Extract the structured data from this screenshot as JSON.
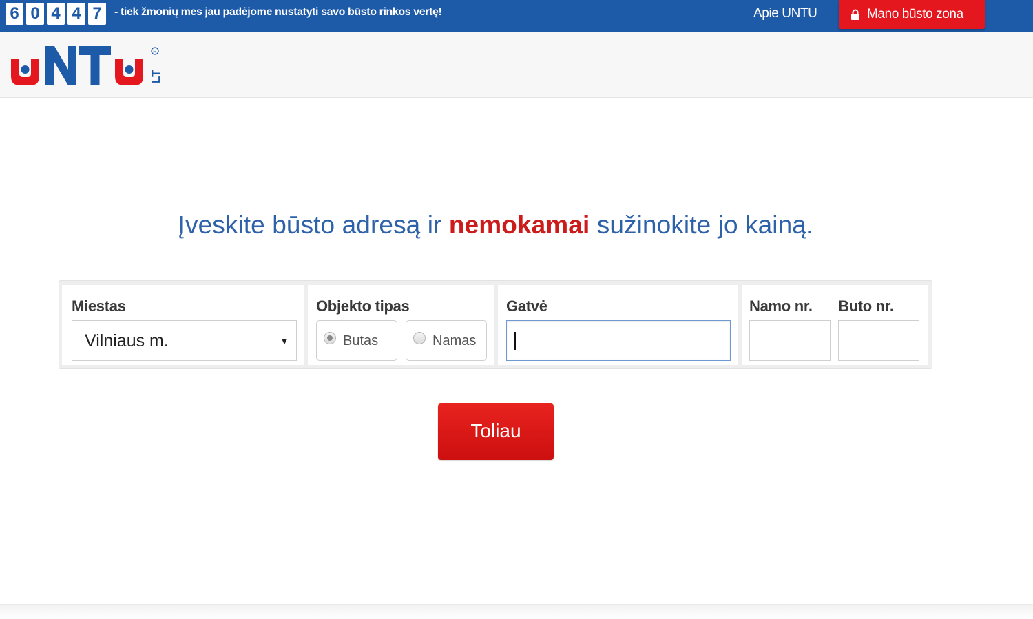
{
  "topbar": {
    "counter_digits": [
      "6",
      "0",
      "4",
      "4",
      "7"
    ],
    "counter_text": "- tiek žmonių mes jau padėjome nustatyti savo būsto rinkos vertę!",
    "about_link": "Apie UNTU",
    "zone_button": "Mano būsto zona",
    "colors": {
      "bar": "#1d5aa8",
      "button": "#e3171d"
    }
  },
  "logo": {
    "wordmark": "uNTu",
    "suffix": "LT",
    "colors": {
      "blue": "#1d5aa8",
      "red": "#e3171d"
    }
  },
  "main": {
    "headline_prefix": "Įveskite būsto adresą ir ",
    "headline_emphasis": "nemokamai",
    "headline_suffix": " sužinokite jo kainą."
  },
  "form": {
    "city": {
      "label": "Miestas",
      "value": "Vilniaus m."
    },
    "object_type": {
      "label": "Objekto tipas",
      "options": [
        {
          "label": "Butas",
          "selected": true
        },
        {
          "label": "Namas",
          "selected": false
        }
      ]
    },
    "street": {
      "label": "Gatvė",
      "value": ""
    },
    "house_no": {
      "label": "Namo nr.",
      "value": ""
    },
    "flat_no": {
      "label": "Buto nr.",
      "value": ""
    },
    "submit_label": "Toliau"
  }
}
